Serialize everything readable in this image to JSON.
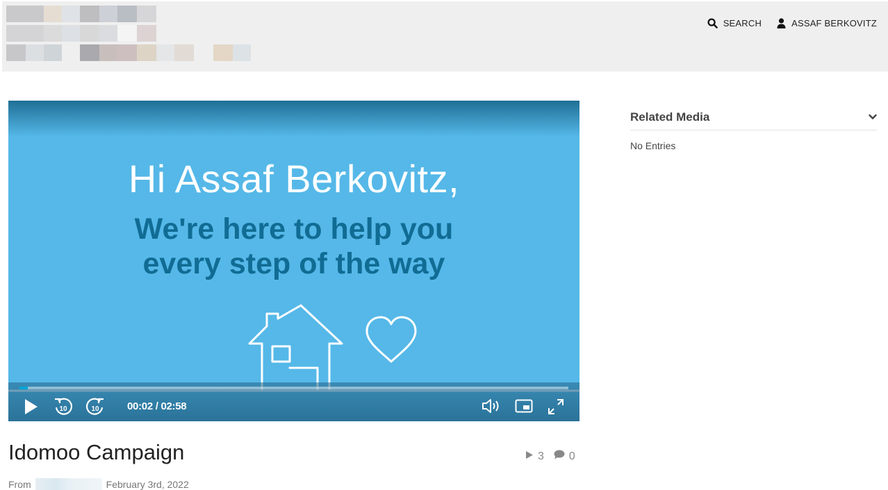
{
  "header": {
    "nav": {
      "search_label": "SEARCH",
      "user_label": "ASSAF BERKOVITZ"
    }
  },
  "player": {
    "greeting": "Hi Assaf Berkovitz,",
    "tagline_line1": "We're here to help you",
    "tagline_line2": "every step of the way",
    "time_display": "00:02 / 02:58",
    "progress_fraction": 0.011,
    "rewind_label": "10",
    "forward_label": "10",
    "colors": {
      "background": "#55b8e8",
      "tagline": "#116c94",
      "progress": "#00a6d6"
    }
  },
  "media": {
    "title": "Idomoo Campaign",
    "plays": "3",
    "comments": "0",
    "from_label": "From",
    "date": "February 3rd, 2022"
  },
  "sidebar": {
    "related_title": "Related Media",
    "empty_text": "No Entries"
  },
  "icons": [
    "search-icon",
    "user-icon",
    "play-icon",
    "rewind-10-icon",
    "forward-10-icon",
    "volume-icon",
    "picture-in-picture-icon",
    "fullscreen-icon",
    "chevron-down-icon",
    "plays-icon",
    "comment-icon"
  ]
}
